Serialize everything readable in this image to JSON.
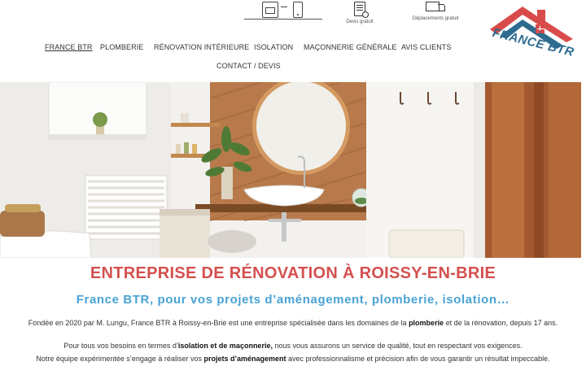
{
  "header": {
    "features": [
      {
        "icon": "document-search-icon",
        "label": "Devis gratuit"
      },
      {
        "icon": "truck-icon",
        "label": "Déplacements gratuit"
      }
    ],
    "contact_icons": [
      "store-icon",
      "phone-icon"
    ]
  },
  "logo": {
    "text": "FRANCE BTR",
    "colors": {
      "roof": "#d94a4a",
      "text": "#2d6b8e"
    }
  },
  "nav": {
    "items": [
      {
        "label": "FRANCE BTR",
        "active": true
      },
      {
        "label": "PLOMBERIE"
      },
      {
        "label": "RÉNOVATION INTÉRIEURE"
      },
      {
        "label": "ISOLATION"
      },
      {
        "label": "MAÇONNERIE GÉNÉRALE"
      },
      {
        "label": "AVIS CLIENTS"
      },
      {
        "label": "CONTACT / DEVIS"
      }
    ]
  },
  "main": {
    "title": "ENTREPRISE DE RÉNOVATION À ROISSY-EN-BRIE",
    "subtitle": "France BTR, pour vos projets d’aménagement, plomberie, isolation…",
    "paragraphs": [
      {
        "before": "Fondée en 2020 par M. Lungu, France BTR à Roissy-en-Brie est une entreprise spécialisée dans les domaines de la ",
        "bold": "plomberie",
        "after": " et de la rénovation, depuis 17 ans."
      },
      {
        "before": "Pour tous vos besoins en termes d’",
        "bold": "isolation et de maçonnerie,",
        "after": " nous vous assurons un service de qualité, tout en respectant vos exigences."
      },
      {
        "before": "Notre équipe expérimentée s’engage à réaliser vos ",
        "bold": "projets d’aménagement",
        "after": " avec professionnalisme et précision afin de vous garantir un résultat impeccable."
      }
    ]
  },
  "colors": {
    "title": "#d4504e",
    "subtitle": "#4aa3d4"
  }
}
